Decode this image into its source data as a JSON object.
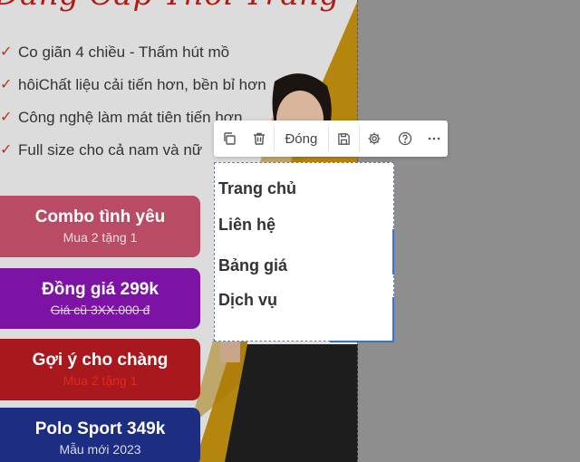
{
  "page": {
    "heading": "Đẳng Cấp Thời Trang",
    "features": [
      "Co giãn 4 chiều - Thấm hút mồ",
      "hôiChất liệu cải tiến hơn, bền bỉ hơn",
      "Công nghệ làm mát tiên tiến hơn",
      "Full size cho cả nam và nữ"
    ],
    "ctas": [
      {
        "title": "Combo tình yêu",
        "subtitle": "Mua 2 tặng 1"
      },
      {
        "title": "Đồng giá 299k",
        "subtitle": "Giá cũ 3XX.000 đ"
      },
      {
        "title": "Gợi ý cho chàng",
        "subtitle": "Mua 2 tặng 1"
      },
      {
        "title": "Polo Sport 349k",
        "subtitle": "Mẫu mới 2023"
      }
    ]
  },
  "toolbar": {
    "icons": [
      "copy-icon",
      "trash-icon",
      "save-icon",
      "gear-icon",
      "help-icon",
      "more-icon"
    ],
    "close_label": "Đóng"
  },
  "menu": {
    "items": [
      "Trang chủ",
      "Liên hệ",
      "Bảng giá",
      "Dịch vụ"
    ]
  },
  "colors": {
    "heading": "#b01a14",
    "cta_combo": "#b94c64",
    "cta_dong_gia": "#7c13a4",
    "cta_goi_y": "#a8181c",
    "cta_polo": "#1d2d82",
    "selection_accent": "#3b6fd8"
  }
}
